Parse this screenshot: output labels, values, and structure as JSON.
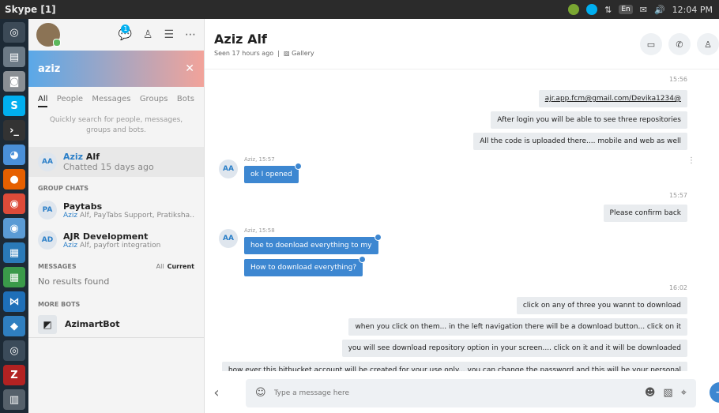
{
  "window": {
    "title": "Skype [1]"
  },
  "tray": {
    "lang": "En",
    "clock": "12:04 PM"
  },
  "sidebar": {
    "notification_count": "1",
    "search_value": "aziz",
    "filters": [
      "All",
      "People",
      "Messages",
      "Groups",
      "Bots"
    ],
    "hint": "Quickly search for people, messages, groups and bots.",
    "top_contact": {
      "initials": "AA",
      "name_highlight": "Aziz",
      "name_rest": " Alf",
      "sub": "Chatted 15 days ago"
    },
    "group_chats_label": "GROUP CHATS",
    "groups": [
      {
        "initials": "PA",
        "name": "Paytabs",
        "sub_hl": "Aziz",
        "sub": " Alf, PayTabs Support, Pratiksha R..."
      },
      {
        "initials": "AD",
        "name": "AJR Development",
        "sub_hl": "Aziz",
        "sub": " Alf, payfort integration"
      }
    ],
    "messages_label": "MESSAGES",
    "messages_all": "All",
    "messages_current": "Current",
    "no_results": "No results found",
    "more_bots_label": "MORE BOTS",
    "bot_name": "AzimartBot"
  },
  "conversation": {
    "title": "Aziz Alf",
    "seen": "Seen 17 hours ago",
    "gallery": "Gallery",
    "msgs": {
      "t1": "15:56",
      "o1": "ajr.app.fcm@gmail.com/Devika1234@",
      "o2": "After login you will be able to see three repositories",
      "o3": "All the code is uploaded there.... mobile and web as well",
      "meta1": "Aziz, 15:57",
      "i1": "ok I opened",
      "t2": "15:57",
      "o4": "Please confirm back",
      "meta2": "Aziz, 15:58",
      "i2": "hoe to doenload everything to my",
      "i3": "How to download everything?",
      "t3": "16:02",
      "o5": "click on any of three you wannt to download",
      "o6": "when you click on them... in the left navigation there will be a download button... click on it",
      "o7": "you will see download repository option in your screen.... click on it and it will be downloaded",
      "o8": "how ever this bitbucket account will be created for your use only... you can change the password and this will be your personal"
    },
    "compose_placeholder": "Type a message here"
  }
}
